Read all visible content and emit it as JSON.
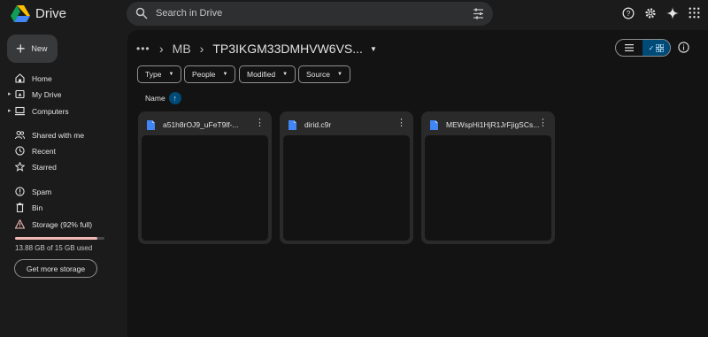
{
  "app": {
    "title": "Drive"
  },
  "search": {
    "placeholder": "Search in Drive"
  },
  "new_button": {
    "label": "New"
  },
  "sidebar": {
    "items": [
      {
        "label": "Home",
        "icon": "home-icon"
      },
      {
        "label": "My Drive",
        "icon": "drive-icon"
      },
      {
        "label": "Computers",
        "icon": "computer-icon"
      },
      {
        "label": "Shared with me",
        "icon": "people-icon"
      },
      {
        "label": "Recent",
        "icon": "clock-icon"
      },
      {
        "label": "Starred",
        "icon": "star-icon"
      },
      {
        "label": "Spam",
        "icon": "spam-icon"
      },
      {
        "label": "Bin",
        "icon": "trash-icon"
      },
      {
        "label": "Storage (92% full)",
        "icon": "warning-icon"
      }
    ],
    "storage_percent": 92,
    "storage_used": "13.88 GB of 15 GB used",
    "get_more_storage": "Get more storage"
  },
  "breadcrumb": {
    "parent": "MB",
    "current": "TP3IKGM33DMHVW6VS..."
  },
  "filters": {
    "type": "Type",
    "people": "People",
    "modified": "Modified",
    "source": "Source"
  },
  "sort": {
    "label": "Name"
  },
  "files": [
    {
      "name": "a51h8rOJ9_uFeT9lf-..."
    },
    {
      "name": "dirid.c9r"
    },
    {
      "name": "MEWspHi1HjR1JrFjigSCs..."
    }
  ],
  "colors": {
    "accent": "#004a77",
    "storage_warning": "#f2b8b5",
    "doc_blue": "#4285f4"
  }
}
